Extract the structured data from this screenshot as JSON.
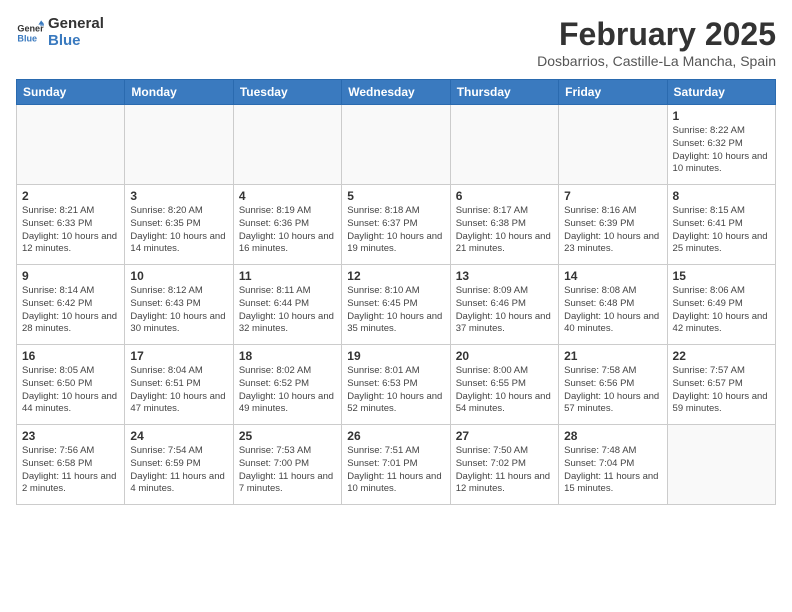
{
  "header": {
    "logo_line1": "General",
    "logo_line2": "Blue",
    "month_title": "February 2025",
    "location": "Dosbarrios, Castille-La Mancha, Spain"
  },
  "weekdays": [
    "Sunday",
    "Monday",
    "Tuesday",
    "Wednesday",
    "Thursday",
    "Friday",
    "Saturday"
  ],
  "weeks": [
    [
      {
        "day": "",
        "info": ""
      },
      {
        "day": "",
        "info": ""
      },
      {
        "day": "",
        "info": ""
      },
      {
        "day": "",
        "info": ""
      },
      {
        "day": "",
        "info": ""
      },
      {
        "day": "",
        "info": ""
      },
      {
        "day": "1",
        "info": "Sunrise: 8:22 AM\nSunset: 6:32 PM\nDaylight: 10 hours and 10 minutes."
      }
    ],
    [
      {
        "day": "2",
        "info": "Sunrise: 8:21 AM\nSunset: 6:33 PM\nDaylight: 10 hours and 12 minutes."
      },
      {
        "day": "3",
        "info": "Sunrise: 8:20 AM\nSunset: 6:35 PM\nDaylight: 10 hours and 14 minutes."
      },
      {
        "day": "4",
        "info": "Sunrise: 8:19 AM\nSunset: 6:36 PM\nDaylight: 10 hours and 16 minutes."
      },
      {
        "day": "5",
        "info": "Sunrise: 8:18 AM\nSunset: 6:37 PM\nDaylight: 10 hours and 19 minutes."
      },
      {
        "day": "6",
        "info": "Sunrise: 8:17 AM\nSunset: 6:38 PM\nDaylight: 10 hours and 21 minutes."
      },
      {
        "day": "7",
        "info": "Sunrise: 8:16 AM\nSunset: 6:39 PM\nDaylight: 10 hours and 23 minutes."
      },
      {
        "day": "8",
        "info": "Sunrise: 8:15 AM\nSunset: 6:41 PM\nDaylight: 10 hours and 25 minutes."
      }
    ],
    [
      {
        "day": "9",
        "info": "Sunrise: 8:14 AM\nSunset: 6:42 PM\nDaylight: 10 hours and 28 minutes."
      },
      {
        "day": "10",
        "info": "Sunrise: 8:12 AM\nSunset: 6:43 PM\nDaylight: 10 hours and 30 minutes."
      },
      {
        "day": "11",
        "info": "Sunrise: 8:11 AM\nSunset: 6:44 PM\nDaylight: 10 hours and 32 minutes."
      },
      {
        "day": "12",
        "info": "Sunrise: 8:10 AM\nSunset: 6:45 PM\nDaylight: 10 hours and 35 minutes."
      },
      {
        "day": "13",
        "info": "Sunrise: 8:09 AM\nSunset: 6:46 PM\nDaylight: 10 hours and 37 minutes."
      },
      {
        "day": "14",
        "info": "Sunrise: 8:08 AM\nSunset: 6:48 PM\nDaylight: 10 hours and 40 minutes."
      },
      {
        "day": "15",
        "info": "Sunrise: 8:06 AM\nSunset: 6:49 PM\nDaylight: 10 hours and 42 minutes."
      }
    ],
    [
      {
        "day": "16",
        "info": "Sunrise: 8:05 AM\nSunset: 6:50 PM\nDaylight: 10 hours and 44 minutes."
      },
      {
        "day": "17",
        "info": "Sunrise: 8:04 AM\nSunset: 6:51 PM\nDaylight: 10 hours and 47 minutes."
      },
      {
        "day": "18",
        "info": "Sunrise: 8:02 AM\nSunset: 6:52 PM\nDaylight: 10 hours and 49 minutes."
      },
      {
        "day": "19",
        "info": "Sunrise: 8:01 AM\nSunset: 6:53 PM\nDaylight: 10 hours and 52 minutes."
      },
      {
        "day": "20",
        "info": "Sunrise: 8:00 AM\nSunset: 6:55 PM\nDaylight: 10 hours and 54 minutes."
      },
      {
        "day": "21",
        "info": "Sunrise: 7:58 AM\nSunset: 6:56 PM\nDaylight: 10 hours and 57 minutes."
      },
      {
        "day": "22",
        "info": "Sunrise: 7:57 AM\nSunset: 6:57 PM\nDaylight: 10 hours and 59 minutes."
      }
    ],
    [
      {
        "day": "23",
        "info": "Sunrise: 7:56 AM\nSunset: 6:58 PM\nDaylight: 11 hours and 2 minutes."
      },
      {
        "day": "24",
        "info": "Sunrise: 7:54 AM\nSunset: 6:59 PM\nDaylight: 11 hours and 4 minutes."
      },
      {
        "day": "25",
        "info": "Sunrise: 7:53 AM\nSunset: 7:00 PM\nDaylight: 11 hours and 7 minutes."
      },
      {
        "day": "26",
        "info": "Sunrise: 7:51 AM\nSunset: 7:01 PM\nDaylight: 11 hours and 10 minutes."
      },
      {
        "day": "27",
        "info": "Sunrise: 7:50 AM\nSunset: 7:02 PM\nDaylight: 11 hours and 12 minutes."
      },
      {
        "day": "28",
        "info": "Sunrise: 7:48 AM\nSunset: 7:04 PM\nDaylight: 11 hours and 15 minutes."
      },
      {
        "day": "",
        "info": ""
      }
    ]
  ]
}
